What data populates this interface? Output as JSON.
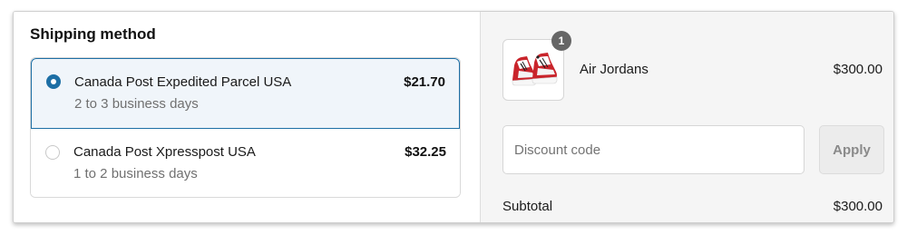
{
  "shipping": {
    "title": "Shipping method",
    "options": [
      {
        "name": "Canada Post Expedited Parcel USA",
        "delivery": "2 to 3 business days",
        "price": "$21.70",
        "selected": true
      },
      {
        "name": "Canada Post Xpresspost USA",
        "delivery": "1 to 2 business days",
        "price": "$32.25",
        "selected": false
      }
    ]
  },
  "summary": {
    "product": {
      "name": "Air Jordans",
      "price": "$300.00",
      "quantity": "1",
      "image_icon": "sneakers-icon"
    },
    "discount": {
      "placeholder": "Discount code",
      "value": "",
      "apply_label": "Apply"
    },
    "subtotal": {
      "label": "Subtotal",
      "value": "$300.00"
    }
  },
  "colors": {
    "accent": "#1d6fa5",
    "selected_bg": "#f0f5fa",
    "summary_bg": "#f5f5f5"
  }
}
